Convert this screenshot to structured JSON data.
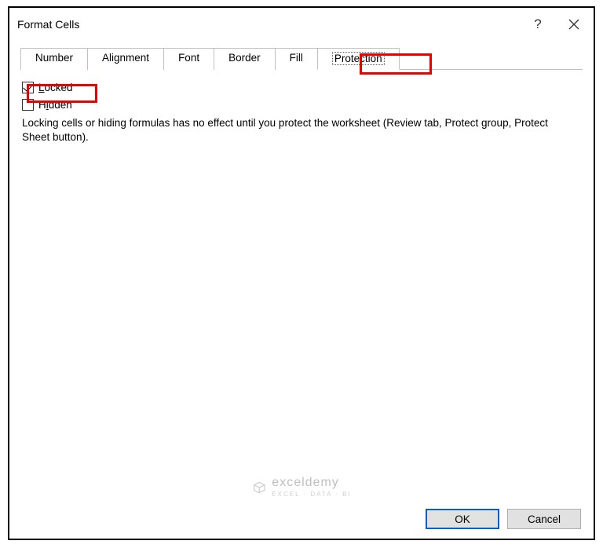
{
  "titlebar": {
    "title": "Format Cells"
  },
  "tabs": [
    {
      "label": "Number"
    },
    {
      "label": "Alignment"
    },
    {
      "label": "Font"
    },
    {
      "label": "Border"
    },
    {
      "label": "Fill"
    },
    {
      "label": "Protection"
    }
  ],
  "protection": {
    "locked_label": "Locked",
    "locked_checked": true,
    "hidden_label": "Hidden",
    "hidden_checked": false,
    "description": "Locking cells or hiding formulas has no effect until you protect the worksheet (Review tab, Protect group, Protect Sheet button)."
  },
  "buttons": {
    "ok": "OK",
    "cancel": "Cancel"
  },
  "watermark": {
    "brand": "exceldemy",
    "tagline": "EXCEL · DATA · BI"
  }
}
